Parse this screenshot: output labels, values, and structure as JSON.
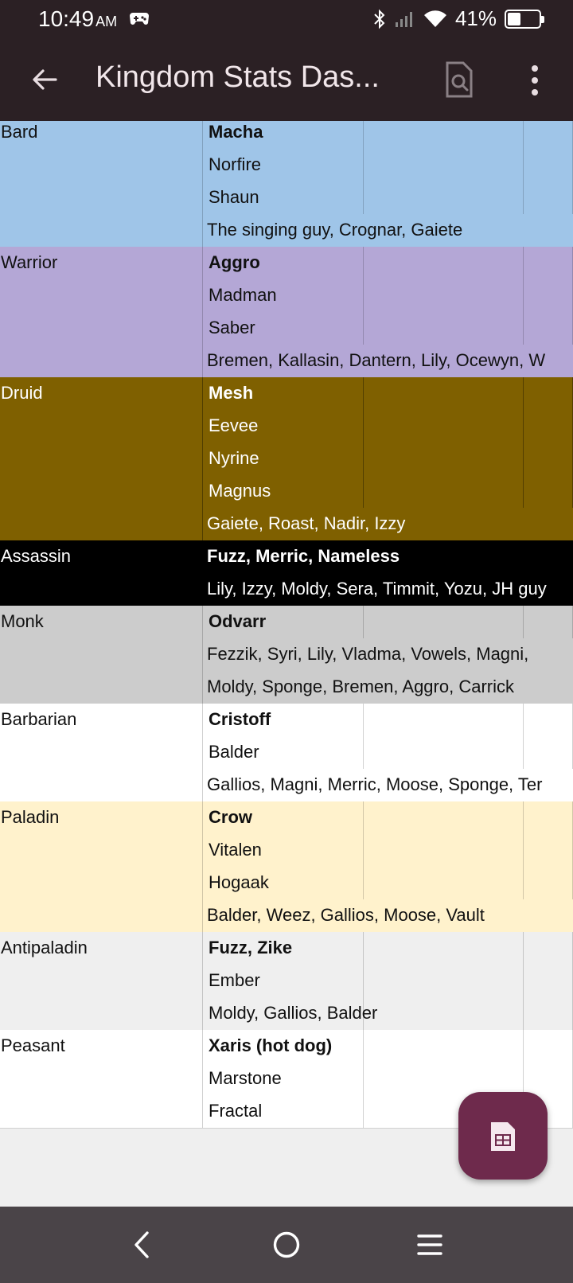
{
  "status": {
    "time": "10:49",
    "ampm": "AM",
    "battery_text": "41%",
    "battery_level": 0.41
  },
  "app_bar": {
    "title": "Kingdom Stats Das..."
  },
  "sheet": {
    "rows": [
      {
        "group": "bard",
        "a": "Bard",
        "b": "Macha",
        "bold": true,
        "wide": false
      },
      {
        "group": "bard",
        "a": "",
        "b": "Norfire",
        "bold": false,
        "wide": false
      },
      {
        "group": "bard",
        "a": "",
        "b": "Shaun",
        "bold": false,
        "wide": false
      },
      {
        "group": "bard",
        "a": "",
        "b": "The singing guy, Crognar, Gaiete",
        "bold": false,
        "wide": true
      },
      {
        "group": "warrior",
        "a": "Warrior",
        "b": "Aggro",
        "bold": true,
        "wide": false
      },
      {
        "group": "warrior",
        "a": "",
        "b": "Madman",
        "bold": false,
        "wide": false
      },
      {
        "group": "warrior",
        "a": "",
        "b": "Saber",
        "bold": false,
        "wide": false
      },
      {
        "group": "warrior",
        "a": "",
        "b": "Bremen, Kallasin, Dantern, Lily, Ocewyn, W",
        "bold": false,
        "wide": true
      },
      {
        "group": "druid",
        "a": "Druid",
        "b": "Mesh",
        "bold": true,
        "wide": false
      },
      {
        "group": "druid",
        "a": "",
        "b": "Eevee",
        "bold": false,
        "wide": false
      },
      {
        "group": "druid",
        "a": "",
        "b": "Nyrine",
        "bold": false,
        "wide": false
      },
      {
        "group": "druid",
        "a": "",
        "b": "Magnus",
        "bold": false,
        "wide": false
      },
      {
        "group": "druid",
        "a": "",
        "b": "Gaiete, Roast, Nadir, Izzy",
        "bold": false,
        "wide": true
      },
      {
        "group": "assassin",
        "a": "Assassin",
        "b": "Fuzz, Merric, Nameless",
        "bold": true,
        "wide": true
      },
      {
        "group": "assassin",
        "a": "",
        "b": "Lily, Izzy, Moldy, Sera, Timmit, Yozu, JH guy",
        "bold": false,
        "wide": true
      },
      {
        "group": "monk",
        "a": "Monk",
        "b": "Odvarr",
        "bold": true,
        "wide": false
      },
      {
        "group": "monk",
        "a": "",
        "b": "Fezzik, Syri, Lily, Vladma, Vowels, Magni,",
        "bold": false,
        "wide": true
      },
      {
        "group": "monk",
        "a": "",
        "b": "Moldy, Sponge, Bremen, Aggro, Carrick",
        "bold": false,
        "wide": true
      },
      {
        "group": "barbarian",
        "a": "Barbarian",
        "b": "Cristoff",
        "bold": true,
        "wide": false
      },
      {
        "group": "barbarian",
        "a": "",
        "b": "Balder",
        "bold": false,
        "wide": false
      },
      {
        "group": "barbarian",
        "a": "",
        "b": "Gallios, Magni, Merric, Moose, Sponge, Ter",
        "bold": false,
        "wide": true
      },
      {
        "group": "paladin",
        "a": "Paladin",
        "b": "Crow",
        "bold": true,
        "wide": false
      },
      {
        "group": "paladin",
        "a": "",
        "b": "Vitalen",
        "bold": false,
        "wide": false
      },
      {
        "group": "paladin",
        "a": "",
        "b": "Hogaak",
        "bold": false,
        "wide": false
      },
      {
        "group": "paladin",
        "a": "",
        "b": "Balder, Weez, Gallios, Moose, Vault",
        "bold": false,
        "wide": true
      },
      {
        "group": "antipaladin",
        "a": "Antipaladin",
        "b": "Fuzz, Zike",
        "bold": true,
        "wide": false
      },
      {
        "group": "antipaladin",
        "a": "",
        "b": "Ember",
        "bold": false,
        "wide": false
      },
      {
        "group": "antipaladin",
        "a": "",
        "b": "Moldy, Gallios, Balder",
        "bold": false,
        "wide": false
      },
      {
        "group": "peasant",
        "a": "Peasant",
        "b": "Xaris (hot dog)",
        "bold": true,
        "wide": false
      },
      {
        "group": "peasant",
        "a": "",
        "b": "Marstone",
        "bold": false,
        "wide": false
      },
      {
        "group": "peasant",
        "a": "",
        "b": "Fractal",
        "bold": false,
        "wide": false
      }
    ]
  },
  "fab": {
    "icon": "sheets-icon"
  },
  "nav": {
    "back": "nav-back-icon",
    "home": "nav-home-icon",
    "recents": "nav-recents-icon"
  }
}
